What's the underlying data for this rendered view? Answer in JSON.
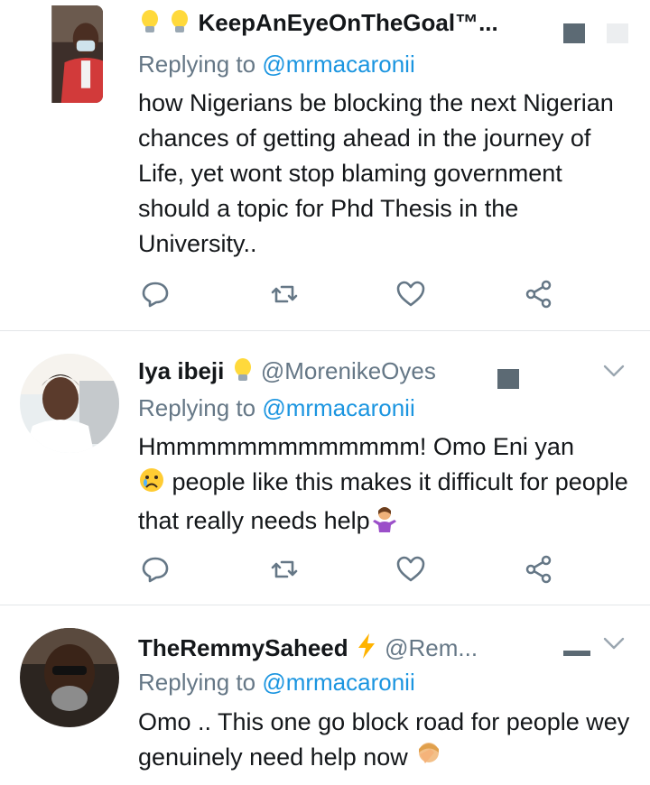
{
  "tweets": [
    {
      "display_name": "KeepAnEyeOnTheGoal™...",
      "name_prefix_icons": "lightbulb-icon x2",
      "replying_prefix": "Replying to ",
      "replying_mention": "@mrmacaronii",
      "body": "how Nigerians be blocking the next Nigerian chances of getting ahead in the journey of Life, yet wont stop blaming government should a topic for Phd Thesis in the University.."
    },
    {
      "display_name": "Iya ibeji",
      "name_suffix_icon": "lightbulb-icon",
      "handle": "@MorenikeOyes",
      "replying_prefix": "Replying to ",
      "replying_mention": "@mrmacaronii",
      "body": "Hmmmmmmmmmmmmm! Omo Eni yan",
      "body_line2": " people like this makes it difficult for people that really needs help",
      "body_emojis": [
        "crying-face-icon",
        "person-shrugging-icon"
      ]
    },
    {
      "display_name": "TheRemmySaheed",
      "name_suffix_icon": "lightning-icon",
      "handle": "@Rem...",
      "replying_prefix": "Replying to ",
      "replying_mention": "@mrmacaronii",
      "body": "Omo .. This one go block road for people wey genuinely need help now",
      "body_emojis": [
        "facepalm-icon"
      ]
    }
  ],
  "colors": {
    "text": "#14171a",
    "secondary": "#657786",
    "link": "#1b95e0",
    "icon": "#657786",
    "divider": "#e3e6e8"
  }
}
